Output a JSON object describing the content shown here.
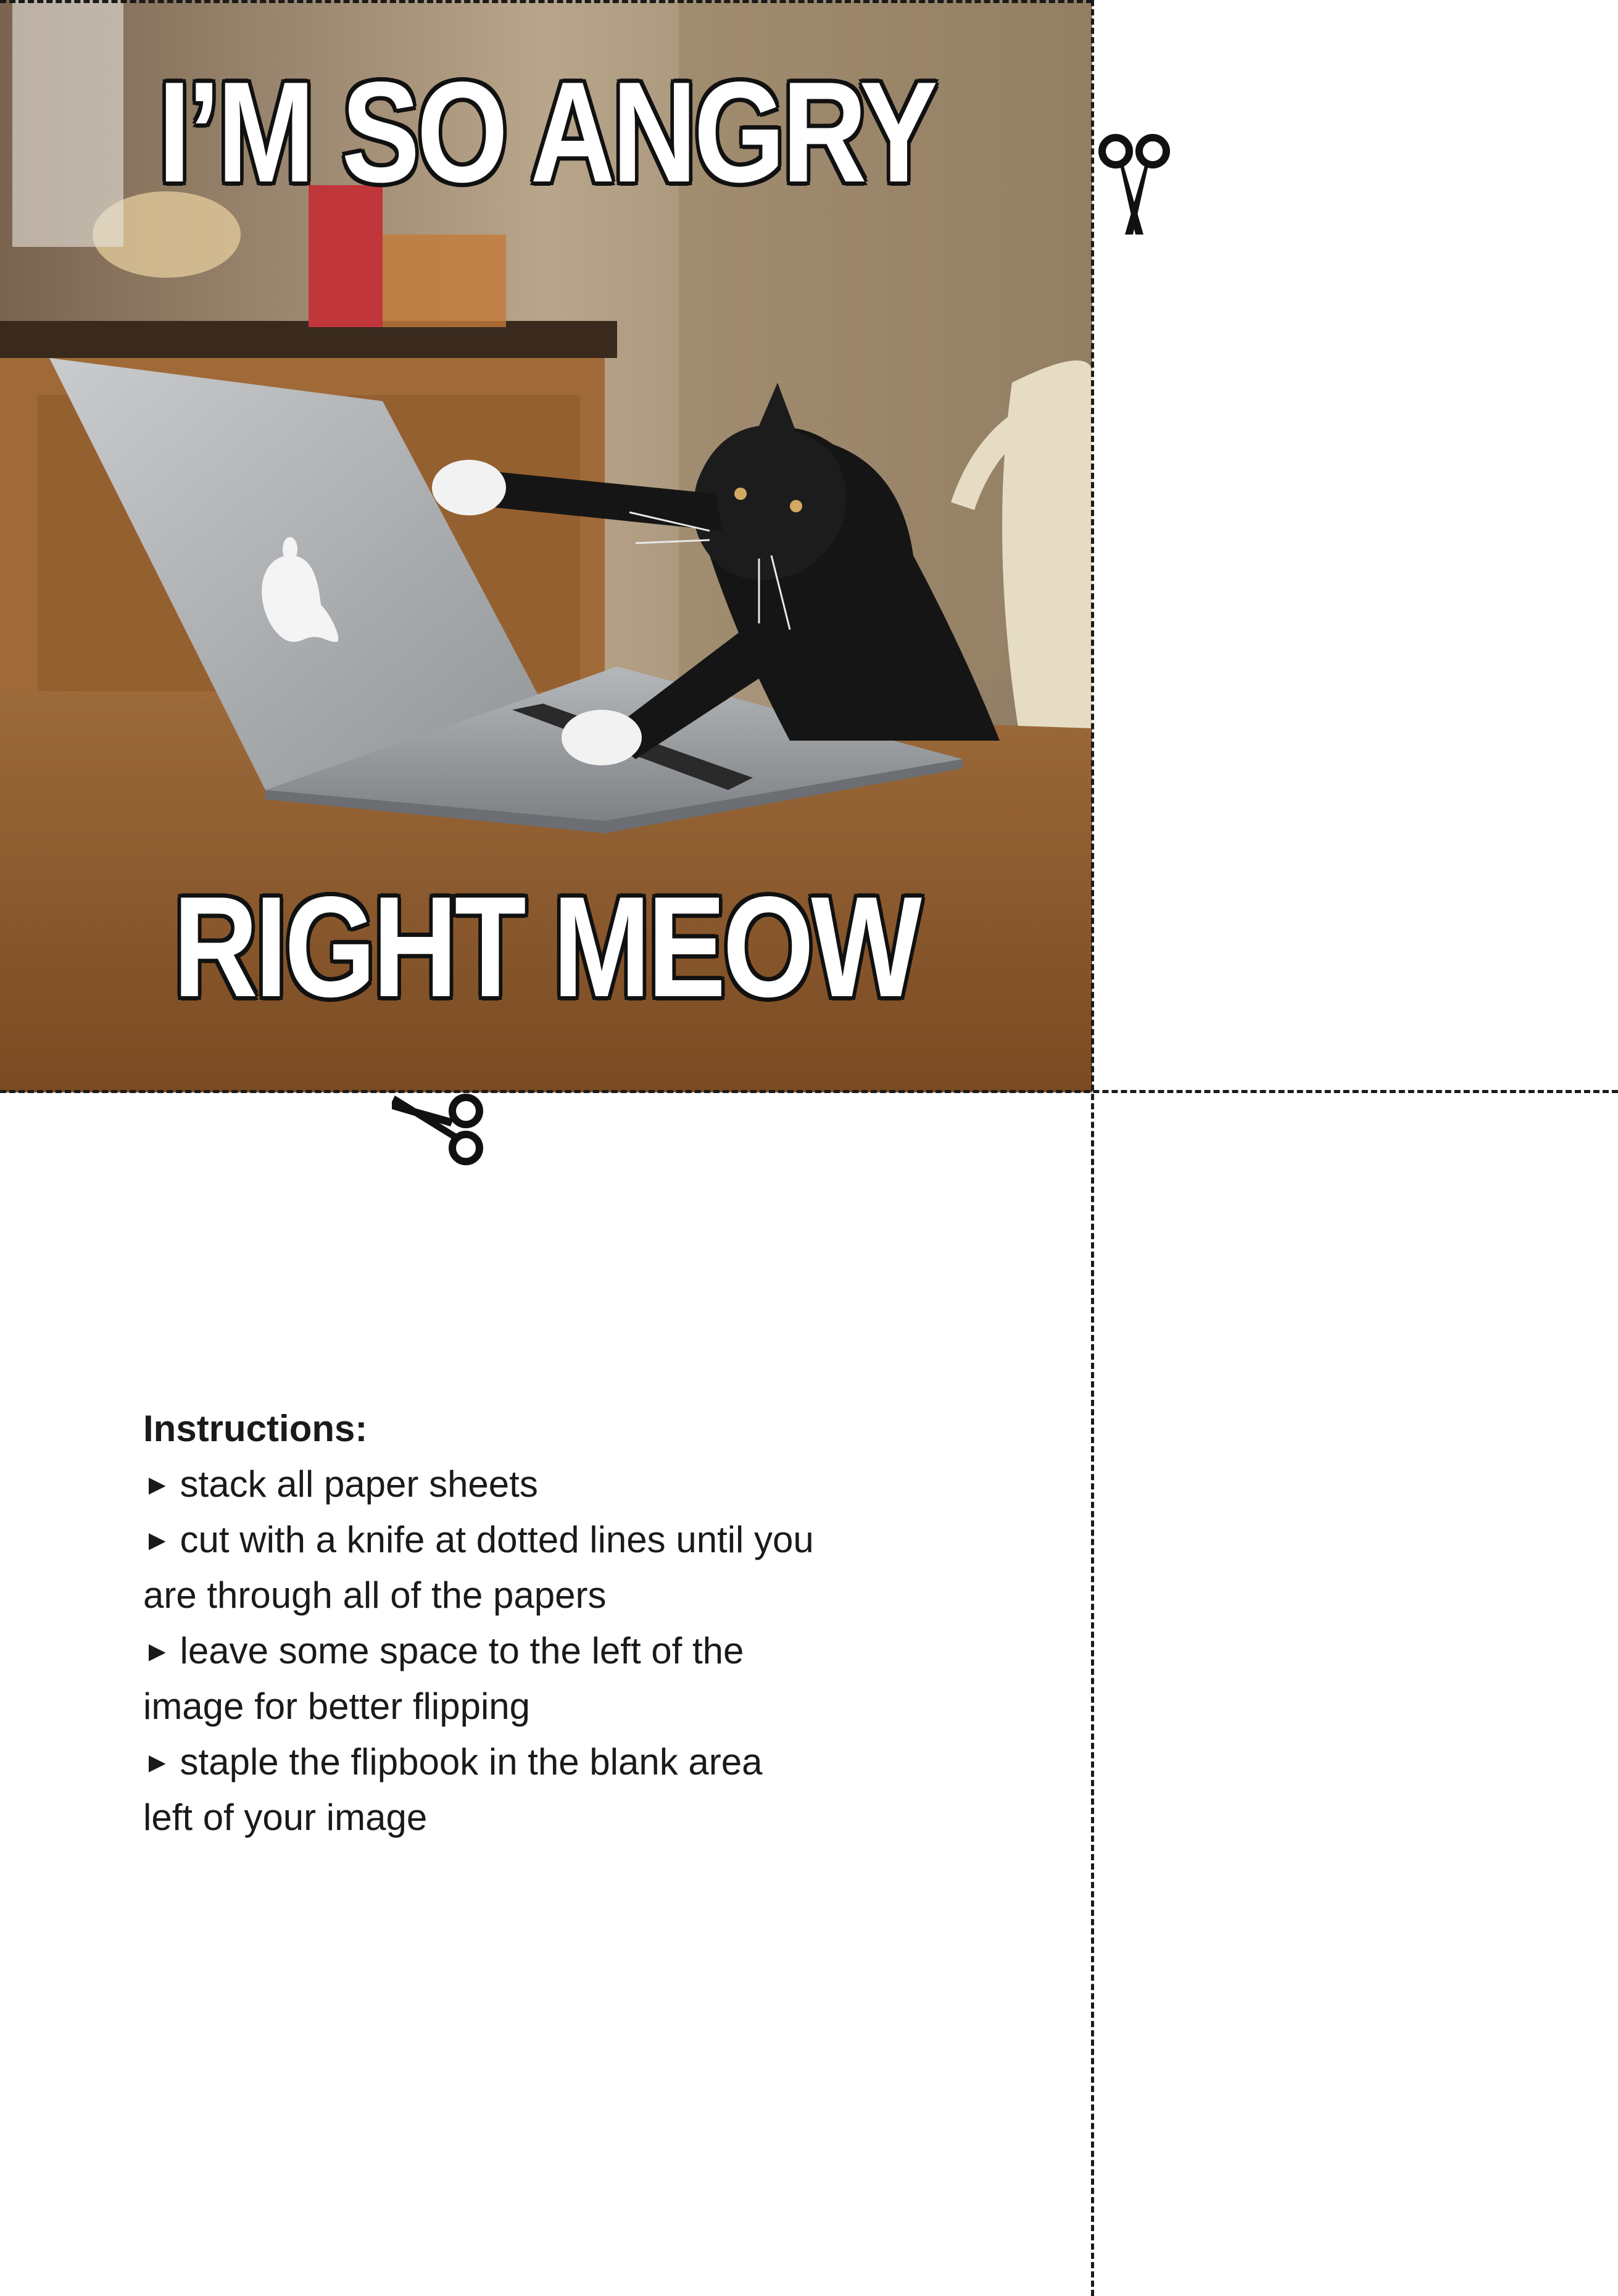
{
  "meme": {
    "top_caption": "I’M SO ANGRY",
    "bottom_caption": "RIGHT MEOW"
  },
  "instructions": {
    "heading": "Instructions:",
    "bullet_glyph": "►",
    "steps": [
      "stack all paper sheets",
      "cut with a knife at dotted lines until you are through all of the papers",
      "leave some space to the left of the image for better flipping",
      "staple the flipbook in the blank area left of your image"
    ]
  },
  "icons": {
    "cut_marker": "scissors-icon"
  }
}
